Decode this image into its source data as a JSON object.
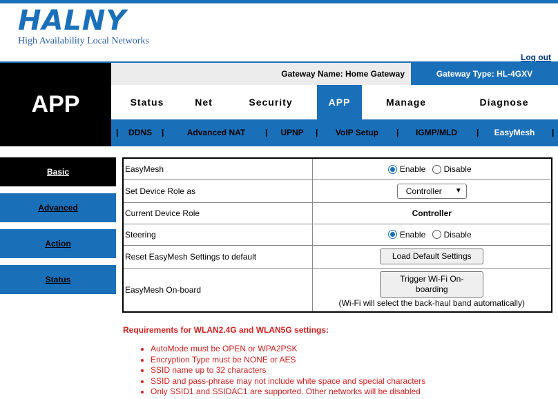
{
  "brand": {
    "logo": "HALNY",
    "tagline": "High Availability Local Networks"
  },
  "header": {
    "logout": "Log out",
    "gateway_name": "Gateway Name: Home Gateway",
    "gateway_type": "Gateway Type: HL-4GXV"
  },
  "section_title": "APP",
  "tabs": [
    {
      "label": "Status",
      "active": false
    },
    {
      "label": "Net",
      "active": false
    },
    {
      "label": "Security",
      "active": false
    },
    {
      "label": "APP",
      "active": true
    },
    {
      "label": "Manage",
      "active": false
    },
    {
      "label": "Diagnose",
      "active": false
    }
  ],
  "subnav": {
    "separator": "|",
    "items": [
      {
        "label": "DDNS",
        "active": false
      },
      {
        "label": "Advanced NAT",
        "active": false
      },
      {
        "label": "UPNP",
        "active": false
      },
      {
        "label": "VoIP Setup",
        "active": false
      },
      {
        "label": "IGMP/MLD",
        "active": false
      },
      {
        "label": "EasyMesh",
        "active": true
      }
    ]
  },
  "sidebar": {
    "items": [
      {
        "label": "Basic",
        "active": true
      },
      {
        "label": "Advanced",
        "active": false
      },
      {
        "label": "Action",
        "active": false
      },
      {
        "label": "Status",
        "active": false
      }
    ]
  },
  "form": {
    "easymesh": {
      "label": "EasyMesh",
      "enable": "Enable",
      "disable": "Disable",
      "selected": "enable"
    },
    "device_role": {
      "label": "Set Device Role as",
      "value": "Controller"
    },
    "current_role": {
      "label": "Current Device Role",
      "value": "Controller"
    },
    "steering": {
      "label": "Steering",
      "enable": "Enable",
      "disable": "Disable",
      "selected": "enable"
    },
    "reset": {
      "label": "Reset EasyMesh Settings to default",
      "button": "Load Default Settings"
    },
    "onboard": {
      "label": "EasyMesh On-board",
      "button": "Trigger Wi-Fi On-boarding",
      "note": "(Wi-Fi will select the back-haul band automatically)"
    }
  },
  "requirements": {
    "title": "Requirements for WLAN2.4G and WLAN5G settings:",
    "items": [
      "AutoMode must be OPEN or WPA2PSK",
      "Encryption Type must be NONE or AES",
      "SSID name up to 32 characters",
      "SSID and pass-phrase may not include white space and special characters",
      "Only SSID1 and SSIDAC1 are supported. Other networks will be disabled"
    ]
  },
  "colors": {
    "accent": "#1a6fb9",
    "warning": "#d42020"
  }
}
